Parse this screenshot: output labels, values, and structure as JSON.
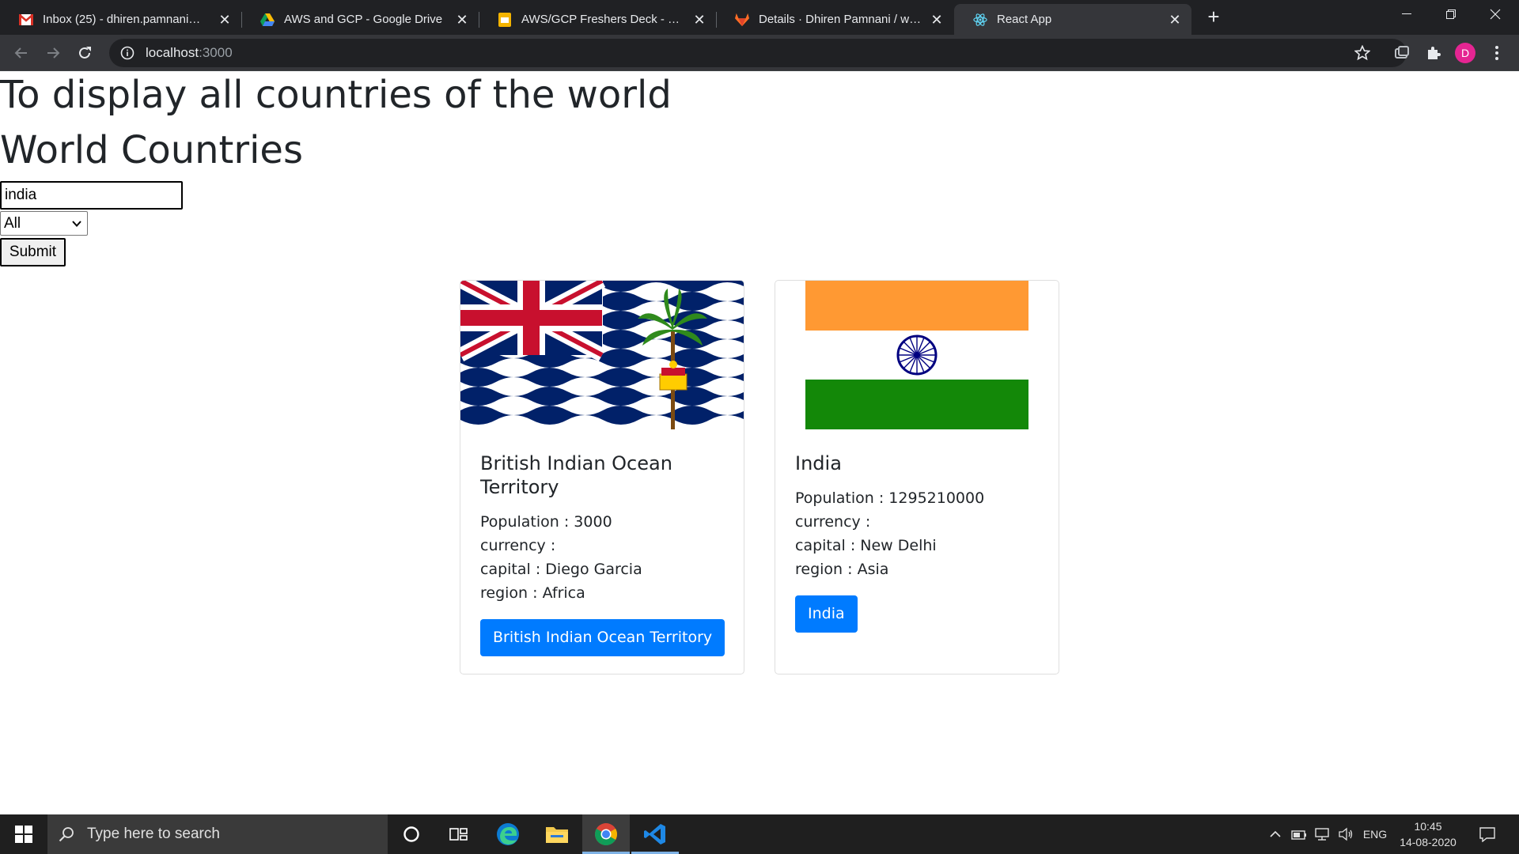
{
  "browser": {
    "tabs": [
      {
        "title": "Inbox (25) - dhiren.pamnani@qu",
        "icon": "gmail-icon"
      },
      {
        "title": "AWS and GCP - Google Drive",
        "icon": "google-drive-icon"
      },
      {
        "title": "AWS/GCP Freshers Deck - Googl",
        "icon": "google-slides-icon"
      },
      {
        "title": "Details · Dhiren Pamnani / world",
        "icon": "gitlab-icon"
      },
      {
        "title": "React App",
        "icon": "react-icon"
      }
    ],
    "url_host": "localhost",
    "url_port": ":3000",
    "profile_initial": "D"
  },
  "page": {
    "heading_1": "To display all countries of the world",
    "heading_2": "World Countries",
    "search_value": "india",
    "region_selected": "All",
    "submit_label": "Submit"
  },
  "cards": [
    {
      "name": "British Indian Ocean Territory",
      "population": "Population : 3000",
      "currency": "currency :",
      "capital": "capital : Diego Garcia",
      "region": "region : Africa",
      "button": "British Indian Ocean Territory"
    },
    {
      "name": "India",
      "population": "Population : 1295210000",
      "currency": "currency :",
      "capital": "capital : New Delhi",
      "region": "region : Asia",
      "button": "India"
    }
  ],
  "taskbar": {
    "search_placeholder": "Type here to search",
    "language": "ENG",
    "time": "10:45",
    "date": "14-08-2020"
  },
  "colors": {
    "primary_button": "#007bff",
    "chrome_dark": "#202124",
    "chrome_toolbar": "#35363a"
  }
}
